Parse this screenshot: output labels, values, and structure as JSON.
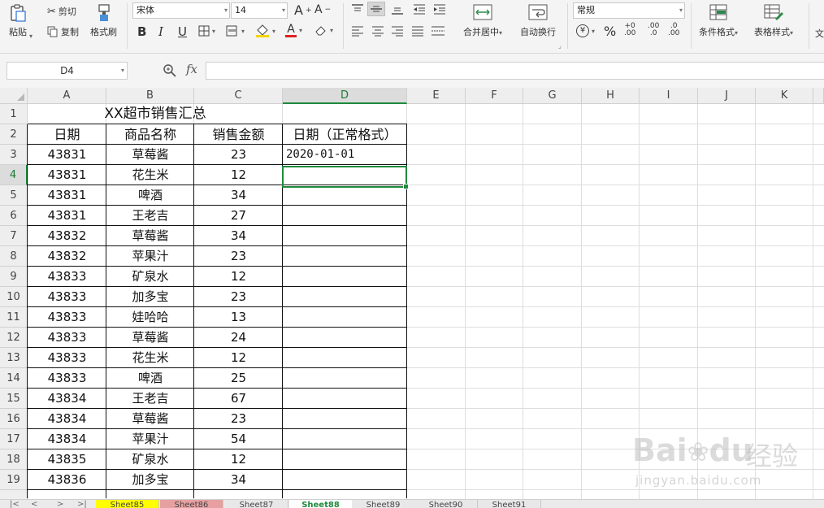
{
  "ribbon": {
    "paste_label": "粘贴",
    "cut_label": "剪切",
    "copy_label": "复制",
    "format_painter_label": "格式刷",
    "font_name": "宋体",
    "font_size": "14",
    "bold": "B",
    "italic": "I",
    "underline": "U",
    "font_color_letter": "A",
    "merge_center_label": "合并居中",
    "wrap_text_label": "自动换行",
    "number_format": "常规",
    "percent": "%",
    "inc_decimal": ".00",
    "dec_decimal": ".0",
    "conditional_format_label": "条件格式",
    "table_style_label": "表格样式",
    "text_cut": "文",
    "font_color_hex": "#e02020",
    "fill_color_hex": "#f2d600"
  },
  "formula_bar": {
    "name_box": "D4",
    "fx": "fx",
    "formula": ""
  },
  "columns": [
    "A",
    "B",
    "C",
    "D",
    "E",
    "F",
    "G",
    "H",
    "I",
    "J",
    "K"
  ],
  "selected_column": "D",
  "selected_row": "4",
  "rows": [
    "1",
    "2",
    "3",
    "4",
    "5",
    "6",
    "7",
    "8",
    "9",
    "10",
    "11",
    "12",
    "13",
    "14",
    "15",
    "16",
    "17",
    "18",
    "19"
  ],
  "sheet": {
    "title": "XX超市销售汇总",
    "headers": [
      "日期",
      "商品名称",
      "销售金额",
      "日期（正常格式）"
    ],
    "data": [
      [
        "43831",
        "草莓酱",
        "23",
        "2020-01-01"
      ],
      [
        "43831",
        "花生米",
        "12",
        ""
      ],
      [
        "43831",
        "啤酒",
        "34",
        ""
      ],
      [
        "43831",
        "王老吉",
        "27",
        ""
      ],
      [
        "43832",
        "草莓酱",
        "34",
        ""
      ],
      [
        "43832",
        "苹果汁",
        "23",
        ""
      ],
      [
        "43833",
        "矿泉水",
        "12",
        ""
      ],
      [
        "43833",
        "加多宝",
        "23",
        ""
      ],
      [
        "43833",
        "娃哈哈",
        "13",
        ""
      ],
      [
        "43833",
        "草莓酱",
        "24",
        ""
      ],
      [
        "43833",
        "花生米",
        "12",
        ""
      ],
      [
        "43833",
        "啤酒",
        "25",
        ""
      ],
      [
        "43834",
        "王老吉",
        "67",
        ""
      ],
      [
        "43834",
        "草莓酱",
        "23",
        ""
      ],
      [
        "43834",
        "苹果汁",
        "54",
        ""
      ],
      [
        "43835",
        "矿泉水",
        "12",
        ""
      ],
      [
        "43836",
        "加多宝",
        "34",
        ""
      ]
    ]
  },
  "tabs": {
    "items": [
      {
        "label": "Sheet85",
        "color": "#ffff00"
      },
      {
        "label": "Sheet86",
        "color": "#e6a0a0"
      },
      {
        "label": "Sheet87",
        "color": "#e8e8e8"
      },
      {
        "label": "Sheet88",
        "color": "#ffffff"
      },
      {
        "label": "Sheet89",
        "color": "#e8e8e8"
      },
      {
        "label": "Sheet90",
        "color": "#e8e8e8"
      },
      {
        "label": "Sheet91",
        "color": "#e8e8e8"
      }
    ],
    "active": "Sheet88"
  },
  "watermark": {
    "brand": "Bai",
    "brand2": "du",
    "cn": "经验",
    "url": "jingyan.baidu.com"
  },
  "accent_color": "#1e8a3c"
}
